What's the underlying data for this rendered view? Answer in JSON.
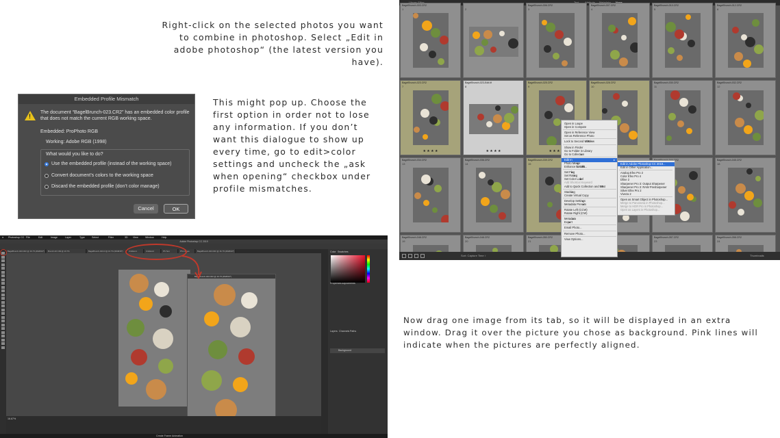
{
  "captions": {
    "step1": "Right-click on the selected photos you want to combine in photoshop. Select „Edit in adobe photoshop“ (the latest version you have).",
    "step2": "This might pop up. Choose the first option in order not to lose any information. If you don’t want this dialogue to show up every time, go to edit>color settings and uncheck the „ask when opening“ checkbox under profile mismatches.",
    "step3": "Now drag one image from its tab, so it will be displayed in an extra window. Drag it over the picture you chose as background. Pink lines will indicate when the pictures are perfectly aligned."
  },
  "dialog": {
    "title": "Embedded Profile Mismatch",
    "message": "The document “BagelBrunch-023.CR2” has an embedded color profile that does not match the current RGB working space.",
    "embedded_label": "Embedded:",
    "embedded_value": "ProPhoto RGB",
    "working_label": "Working:",
    "working_value": "Adobe RGB (1998)",
    "question": "What would you like to do?",
    "options": [
      "Use the embedded profile (instead of the working space)",
      "Convert document’s colors to the working space",
      "Discard the embedded profile (don’t color manage)"
    ],
    "selected_option": 0,
    "cancel_label": "Cancel",
    "ok_label": "OK"
  },
  "lightroom": {
    "filter_label": "Library Filter:",
    "filter_tabs": [
      "Text",
      "Attribute",
      "Metadata",
      "None"
    ],
    "cells": [
      {
        "label": "1",
        "file": "BagelBrunch-003.CR2"
      },
      {
        "label": "2",
        "file": ""
      },
      {
        "label": "3",
        "file": "BagelBrunch-006.CR2"
      },
      {
        "label": "4",
        "file": "BagelBrunch-007.CR2"
      },
      {
        "label": "5",
        "file": "BagelBrunch-010.CR2"
      },
      {
        "label": "6",
        "file": "BagelBrunch-012.CR2"
      },
      {
        "label": "7",
        "file": "BagelBrunch-023.CR2"
      },
      {
        "label": "8",
        "file": "BagelBrunch-023-Edit.tif"
      },
      {
        "label": "9",
        "file": "BagelBrunch-025.CR2"
      },
      {
        "label": "10",
        "file": "BagelBrunch-028.CR2"
      },
      {
        "label": "11",
        "file": "BagelBrunch-030.CR2"
      },
      {
        "label": "12",
        "file": "BagelBrunch-032.CR2"
      },
      {
        "label": "13",
        "file": "BagelBrunch-034.CR2"
      },
      {
        "label": "14",
        "file": "BagelBrunch-036.CR2"
      },
      {
        "label": "15",
        "file": "BagelBrunch-039.CR2"
      },
      {
        "label": "16",
        "file": "BagelBrunch-041.CR2"
      },
      {
        "label": "17",
        "file": "BagelBrunch-044.CR2"
      },
      {
        "label": "18",
        "file": "BagelBrunch-045.CR2"
      },
      {
        "label": "19",
        "file": "BagelBrunch-048.CR2"
      },
      {
        "label": "20",
        "file": "BagelBrunch-048.CR2"
      },
      {
        "label": "21",
        "file": "BagelBrunch-050.CR2"
      },
      {
        "label": "22",
        "file": "BagelBrunch-055.CR2"
      },
      {
        "label": "23",
        "file": "BagelBrunch-057.CR2"
      },
      {
        "label": "24",
        "file": "BagelBrunch-058.CR2"
      }
    ],
    "stars": "★ ★ ★ ★",
    "context_menu": [
      {
        "label": "Open in Loupe"
      },
      {
        "label": "Open in Compare"
      },
      {
        "sep": true
      },
      {
        "label": "Open in Reference View"
      },
      {
        "label": "Set as Reference Photo"
      },
      {
        "sep": true
      },
      {
        "label": "Lock to Second Window",
        "shortcut": "⇧⌘↩"
      },
      {
        "sep": true
      },
      {
        "label": "Show in Finder"
      },
      {
        "label": "Go to Folder in Library"
      },
      {
        "label": "Go to Collection",
        "sub": true
      },
      {
        "sep": true
      },
      {
        "label": "Edit In",
        "sub": true,
        "highlight": true
      },
      {
        "label": "Photo Merge",
        "sub": true
      },
      {
        "label": "Enhance Details...",
        "shortcut": "⌥⇧⌘I"
      },
      {
        "sep": true
      },
      {
        "label": "Set Flag",
        "sub": true
      },
      {
        "label": "Set Rating",
        "sub": true
      },
      {
        "label": "Set Color Label",
        "sub": true
      },
      {
        "label": "Add Shortcut Keyword",
        "dim": true
      },
      {
        "label": "Add to Quick Collection and Next",
        "shortcut": "⇧B"
      },
      {
        "sep": true
      },
      {
        "label": "Stacking",
        "sub": true
      },
      {
        "label": "Create Virtual Copy"
      },
      {
        "sep": true
      },
      {
        "label": "Develop Settings",
        "sub": true
      },
      {
        "label": "Metadata Presets",
        "sub": true
      },
      {
        "sep": true
      },
      {
        "label": "Rotate Left (CCW)"
      },
      {
        "label": "Rotate Right (CW)"
      },
      {
        "sep": true
      },
      {
        "label": "Metadata",
        "sub": true
      },
      {
        "label": "Export",
        "sub": true
      },
      {
        "sep": true
      },
      {
        "label": "Email Photo..."
      },
      {
        "sep": true
      },
      {
        "label": "Remove Photo..."
      },
      {
        "sep": true
      },
      {
        "label": "View Options..."
      }
    ],
    "submenu": [
      {
        "label": "Edit in Adobe Photoshop CC 2019...",
        "highlight": true
      },
      {
        "label": "Edit in Other Application..."
      },
      {
        "sep": true
      },
      {
        "label": "Analog Efex Pro 2"
      },
      {
        "label": "Color Efex Pro 4"
      },
      {
        "label": "Dfine 2"
      },
      {
        "label": "Sharpener Pro 3: Output Sharpener"
      },
      {
        "label": "Sharpener Pro 3: RAW Presharpener"
      },
      {
        "label": "Silver Efex Pro 2"
      },
      {
        "label": "Viveza 2"
      },
      {
        "sep": true
      },
      {
        "label": "Open as Smart Object in Photoshop..."
      },
      {
        "label": "Merge to Panorama in Photoshop...",
        "dim": true
      },
      {
        "label": "Merge to HDR Pro in Photoshop...",
        "dim": true
      },
      {
        "label": "Open as Layers in Photoshop...",
        "dim": true
      }
    ],
    "sort_label": "Sort: Capture Time ↕",
    "thumbnails_label": "Thumbnails"
  },
  "photoshop": {
    "menu": [
      "Photoshop CC",
      "File",
      "Edit",
      "Image",
      "Layer",
      "Type",
      "Select",
      "Filter",
      "3D",
      "View",
      "Window",
      "Help"
    ],
    "app_title": "Adobe Photoshop CC 2019",
    "tabs": [
      "BagelBrunch-023.CR2 @ 16.7% (RGB/16*)",
      "Brunch-02 CR2 @ 16.7%",
      "BagelBrunch-023.tif @ 16.7% (RGB/16*)",
      "Untitled-1",
      "Untitled-2",
      "PS Text",
      "PS Images",
      "BagelBrunch-023.CR2 @ 16.7% (RGB/16*)"
    ],
    "float_title": "BagelBrunch-023.CR2 @ 16.7% (RGB/16*)",
    "panels": [
      "Color",
      "Swatches",
      "Properties",
      "Adjustments",
      "Layers",
      "Channels",
      "Paths"
    ],
    "layer_name": "Background",
    "status_left": "16.67%",
    "bottom_label": "Create Frame Animation",
    "colors": {
      "annotation": "#c0392b",
      "accent": "#2f6fd6"
    }
  }
}
